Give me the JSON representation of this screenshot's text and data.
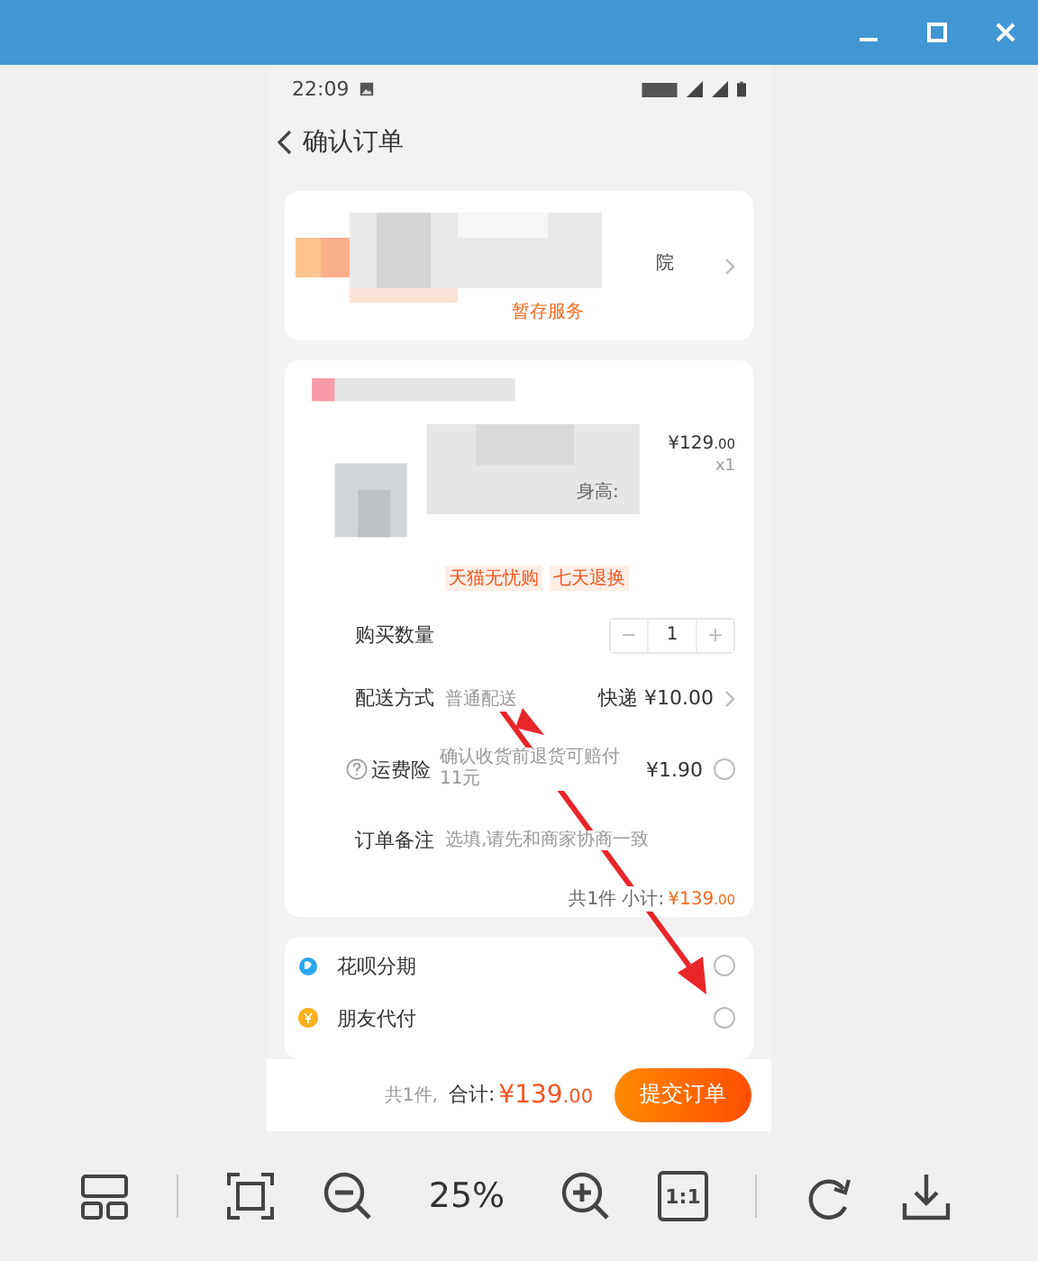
{
  "status_bar": {
    "time": "22:09"
  },
  "header": {
    "title": "确认订单"
  },
  "address": {
    "text_1": "院",
    "text_2": "暂存服务"
  },
  "product": {
    "fragment": "身高:",
    "price": "¥129",
    "price_decimal": ".00",
    "quantity": "x1",
    "tags": [
      "天猫无忧购",
      "七天退换"
    ]
  },
  "options": [
    {
      "kind": "stepper",
      "label": "购买数量",
      "minus": "−",
      "value": "1",
      "plus": "+"
    },
    {
      "kind": "shipping",
      "label": "配送方式",
      "hint": "普通配送",
      "value": "快递 ¥10.00"
    },
    {
      "kind": "insurance",
      "label": "运费险",
      "hint": "确认收货前退货可赔付11元",
      "value": "¥1.90",
      "checked": false
    },
    {
      "kind": "note",
      "label": "订单备注",
      "placeholder": "选填,请先和商家协商一致"
    }
  ],
  "subtotal": {
    "label": "共1件 小计:",
    "amount": "¥139",
    "decimal": ".00"
  },
  "payments": [
    {
      "kind": "huabei",
      "label": "花呗分期",
      "selected": false
    },
    {
      "kind": "friend",
      "label": "朋友代付",
      "selected": false
    }
  ],
  "footer": {
    "count": "共1件,",
    "total_label": "合计:",
    "amount": "¥139",
    "decimal": ".00",
    "submit": "提交订单"
  },
  "viewer": {
    "zoom": "25%",
    "actual_size": "1:1"
  }
}
